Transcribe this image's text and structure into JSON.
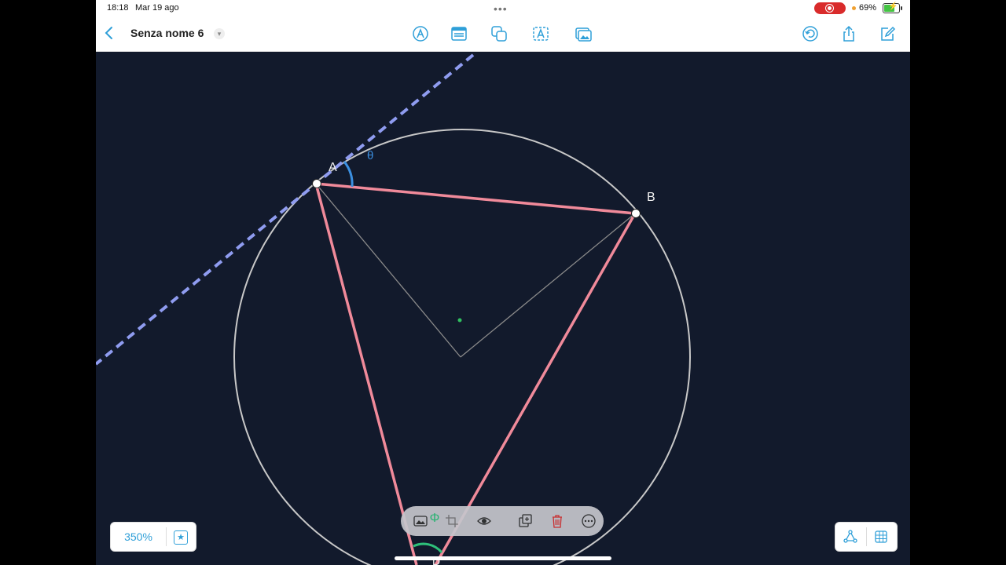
{
  "status": {
    "time": "18:18",
    "date": "Mar 19 ago",
    "battery": "69%"
  },
  "toolbar": {
    "title": "Senza nome 6",
    "icons": [
      "back-icon",
      "pen-icon",
      "notes-icon",
      "shapes-icon",
      "text-icon",
      "image-icon",
      "undo-icon",
      "share-icon",
      "edit-icon"
    ]
  },
  "canvas": {
    "points": {
      "a": "A",
      "b": "B",
      "d": "D"
    },
    "angle": "θ",
    "colors": {
      "background": "#121a2c",
      "triangle": "#f08a9a",
      "circle": "#c8c8c8",
      "tangent": "#8f9cf0",
      "angle_arc": "#3b8fe0",
      "center": "#30c060",
      "arc_d": "#2ec07a"
    }
  },
  "zoom": {
    "value": "350%"
  },
  "context_menu": {
    "items": [
      "image-icon",
      "phi-icon",
      "crop-icon",
      "eye-icon",
      "duplicate-icon",
      "trash-icon",
      "more-icon"
    ]
  }
}
